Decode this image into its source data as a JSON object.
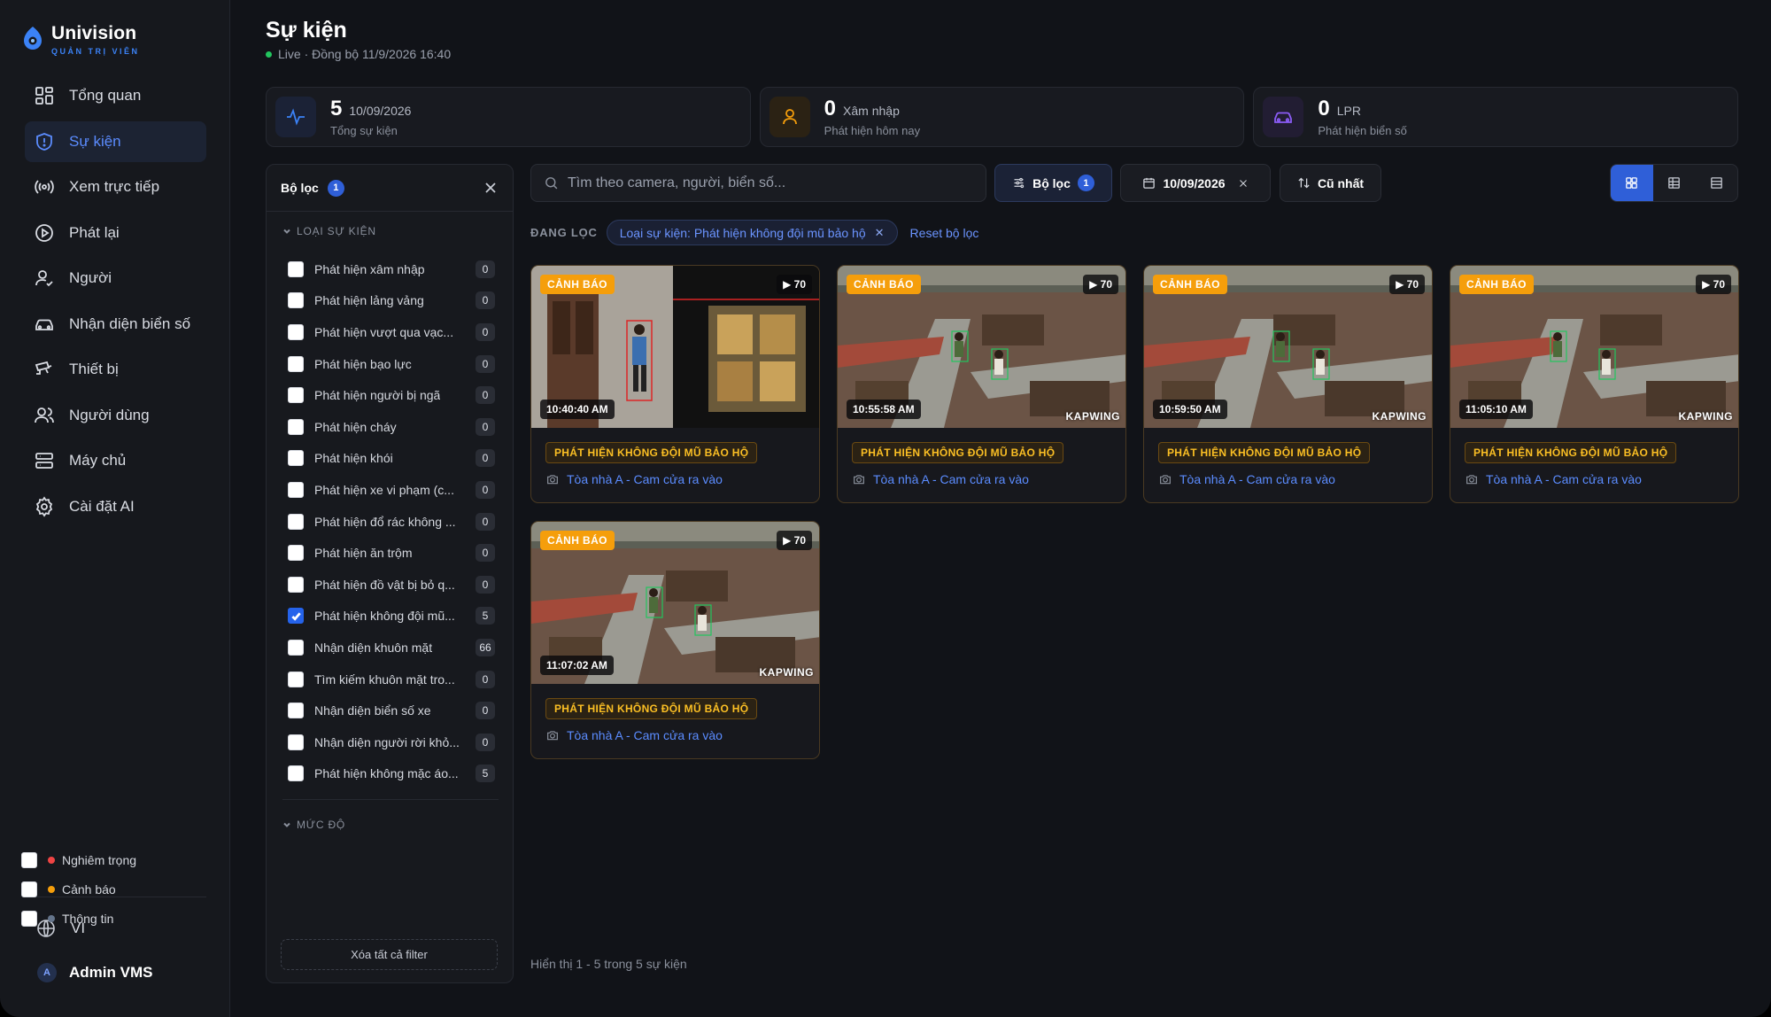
{
  "brand": {
    "name": "Univision",
    "sub": "QUẢN TRỊ VIÊN",
    "accent": "#3b82f6"
  },
  "nav": [
    {
      "label": "Tổng quan",
      "icon": "dashboard-icon"
    },
    {
      "label": "Sự kiện",
      "icon": "shield-icon",
      "active": true
    },
    {
      "label": "Xem trực tiếp",
      "icon": "broadcast-icon"
    },
    {
      "label": "Phát lại",
      "icon": "play-circle-icon"
    },
    {
      "label": "Người",
      "icon": "user-check-icon"
    },
    {
      "label": "Nhận diện biển số",
      "icon": "car-icon"
    },
    {
      "label": "Thiết bị",
      "icon": "camera-device-icon"
    },
    {
      "label": "Người dùng",
      "icon": "users-icon"
    },
    {
      "label": "Máy chủ",
      "icon": "server-icon"
    },
    {
      "label": "Cài đặt AI",
      "icon": "gear-icon"
    }
  ],
  "sidebar_bottom": {
    "language": "VI",
    "user": "Admin VMS",
    "avatar_initial": "A"
  },
  "header": {
    "title": "Sự kiện",
    "live": "Live · Đồng bộ 11/9/2026 16:40"
  },
  "stats": [
    {
      "num": "5",
      "unit": "10/09/2026",
      "sub": "Tổng sự kiện",
      "icon": "activity-icon",
      "color": "#3b82f6"
    },
    {
      "num": "0",
      "unit": "Xâm nhập",
      "sub": "Phát hiện hôm nay",
      "icon": "person-icon",
      "color": "#f59e0b"
    },
    {
      "num": "0",
      "unit": "LPR",
      "sub": "Phát hiện biển số",
      "icon": "car-icon",
      "color": "#8b5cf6"
    }
  ],
  "filter": {
    "title": "Bộ lọc",
    "count": "1",
    "type_section": "LOẠI SỰ KIỆN",
    "types": [
      {
        "label": "Phát hiện xâm nhập",
        "count": "0"
      },
      {
        "label": "Phát hiện lảng vảng",
        "count": "0"
      },
      {
        "label": "Phát hiện vượt qua vạc...",
        "count": "0"
      },
      {
        "label": "Phát hiện bạo lực",
        "count": "0"
      },
      {
        "label": "Phát hiện người bị ngã",
        "count": "0"
      },
      {
        "label": "Phát hiện cháy",
        "count": "0"
      },
      {
        "label": "Phát hiện khói",
        "count": "0"
      },
      {
        "label": "Phát hiện xe vi phạm (c...",
        "count": "0"
      },
      {
        "label": "Phát hiện đổ rác không ...",
        "count": "0"
      },
      {
        "label": "Phát hiện ăn trộm",
        "count": "0"
      },
      {
        "label": "Phát hiện đồ vật bị bỏ q...",
        "count": "0"
      },
      {
        "label": "Phát hiện không đội mũ...",
        "count": "5",
        "checked": true
      },
      {
        "label": "Nhận diện khuôn mặt",
        "count": "66"
      },
      {
        "label": "Tìm kiếm khuôn mặt tro...",
        "count": "0"
      },
      {
        "label": "Nhận diện biển số xe",
        "count": "0"
      },
      {
        "label": "Nhận diện người rời khỏ...",
        "count": "0"
      },
      {
        "label": "Phát hiện không mặc áo...",
        "count": "5"
      }
    ],
    "severity_section": "MỨC ĐỘ",
    "severities": [
      {
        "label": "Nghiêm trọng",
        "color": "#ef4444"
      },
      {
        "label": "Cảnh báo",
        "color": "#f59e0b"
      },
      {
        "label": "Thông tin",
        "color": "#64748b"
      }
    ],
    "clear_all": "Xóa tất cả filter"
  },
  "toolbar": {
    "search_placeholder": "Tìm theo camera, người, biển số...",
    "filter_label": "Bộ lọc",
    "filter_count": "1",
    "date_label": "10/09/2026",
    "sort_label": "Cũ nhất"
  },
  "active_filters": {
    "label": "ĐANG LỌC",
    "chip": "Loại sự kiện: Phát hiện không đội mũ bảo hộ",
    "reset": "Reset bộ lọc"
  },
  "events": [
    {
      "severity": "CẢNH BÁO",
      "frames": "▶ 70",
      "time": "10:40:40 AM",
      "type": "PHÁT HIỆN KHÔNG ĐỘI MŨ BẢO HỘ",
      "camera": "Tòa nhà A - Cam cửa ra vào",
      "watermark": "",
      "scene": "indoor"
    },
    {
      "severity": "CẢNH BÁO",
      "frames": "▶ 70",
      "time": "10:55:58 AM",
      "type": "PHÁT HIỆN KHÔNG ĐỘI MŨ BẢO HỘ",
      "camera": "Tòa nhà A - Cam cửa ra vào",
      "watermark": "KAPWING",
      "scene": "site"
    },
    {
      "severity": "CẢNH BÁO",
      "frames": "▶ 70",
      "time": "10:59:50 AM",
      "type": "PHÁT HIỆN KHÔNG ĐỘI MŨ BẢO HỘ",
      "camera": "Tòa nhà A - Cam cửa ra vào",
      "watermark": "KAPWING",
      "scene": "site"
    },
    {
      "severity": "CẢNH BÁO",
      "frames": "▶ 70",
      "time": "11:05:10 AM",
      "type": "PHÁT HIỆN KHÔNG ĐỘI MŨ BẢO HỘ",
      "camera": "Tòa nhà A - Cam cửa ra vào",
      "watermark": "KAPWING",
      "scene": "site"
    },
    {
      "severity": "CẢNH BÁO",
      "frames": "▶ 70",
      "time": "11:07:02 AM",
      "type": "PHÁT HIỆN KHÔNG ĐỘI MŨ BẢO HỘ",
      "camera": "Tòa nhà A - Cam cửa ra vào",
      "watermark": "KAPWING",
      "scene": "site"
    }
  ],
  "footer": "Hiển thị 1 - 5 trong 5 sự kiện"
}
